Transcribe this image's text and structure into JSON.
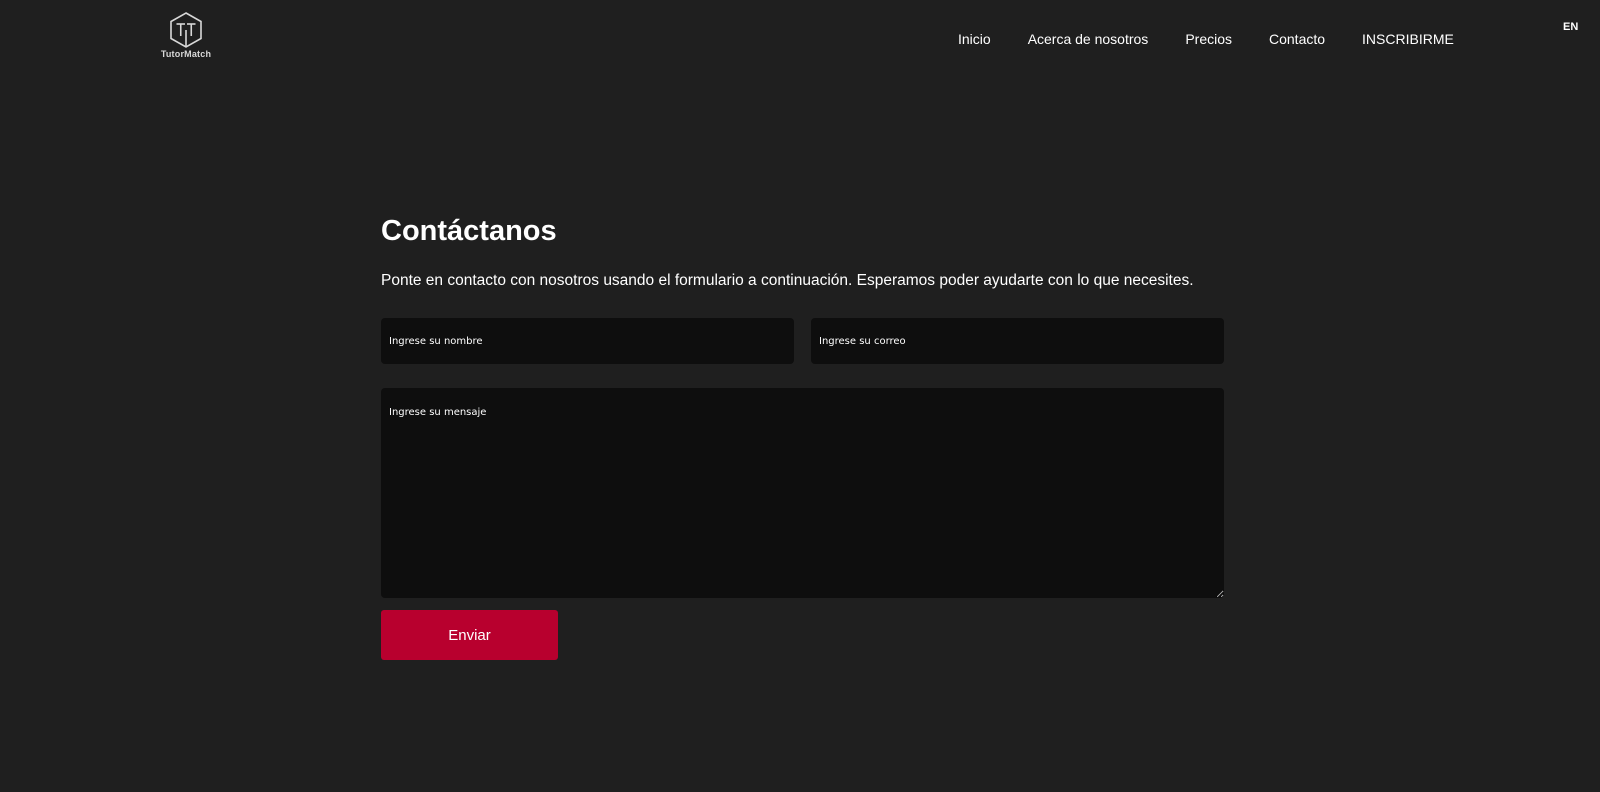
{
  "brand": {
    "name": "TutorMatch",
    "icon": "tutormatch-logo-icon"
  },
  "nav": {
    "items": [
      {
        "label": "Inicio"
      },
      {
        "label": "Acerca de nosotros"
      },
      {
        "label": "Precios"
      },
      {
        "label": "Contacto"
      },
      {
        "label": "INSCRIBIRME"
      }
    ],
    "language": "EN"
  },
  "contact": {
    "title": "Contáctanos",
    "subtitle": "Ponte en contacto con nosotros usando el formulario a continuación. Esperamos poder ayudarte con lo que necesites.",
    "name_placeholder": "Ingrese su nombre",
    "email_placeholder": "Ingrese su correo",
    "message_placeholder": "Ingrese su mensaje",
    "submit_label": "Enviar"
  },
  "colors": {
    "background": "#1f1f1f",
    "input_background": "#0e0e0e",
    "accent": "#b8002e",
    "text": "#ffffff"
  }
}
